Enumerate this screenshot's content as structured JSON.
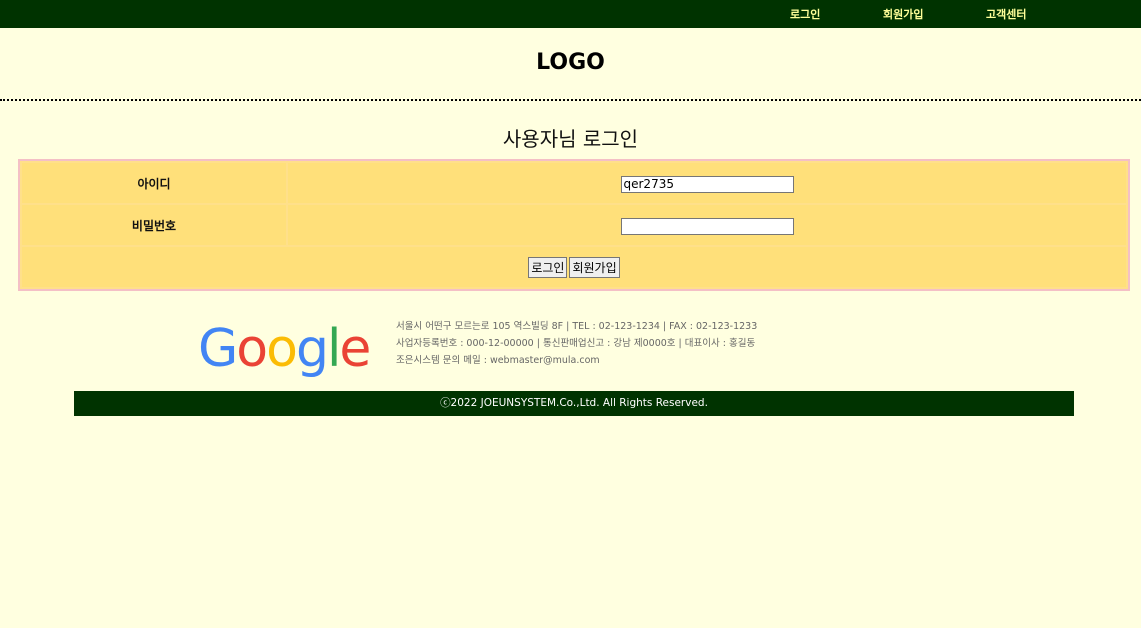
{
  "topnav": {
    "login": "로그인",
    "signup": "회원가입",
    "support": "고객센터"
  },
  "header": {
    "logo": "LOGO"
  },
  "main": {
    "title": "사용자님 로그인",
    "id_label": "아이디",
    "id_value": "qer2735",
    "password_label": "비밀번호",
    "password_value": "",
    "login_button": "로그인",
    "signup_button": "회원가입"
  },
  "footer": {
    "logo_letters": [
      "G",
      "o",
      "o",
      "g",
      "l",
      "e"
    ],
    "address_line": "서울시 어떤구 모르는로 105 역스빌딩 8F | TEL : 02-123-1234 | FAX : 02-123-1233",
    "business_line": "사업자등록번호 : 000-12-00000 | 통신판매업신고 : 강남 제0000호 | 대표이사 : 홍길동",
    "email_line": "조은시스템 문의 메일 : webmaster@mula.com",
    "copyright": "ⓒ2022 JOEUNSYSTEM.Co.,Ltd. All Rights Reserved."
  },
  "colors": {
    "topbar": "#003300",
    "background": "#ffffe0",
    "table_bg": "#ffe07a",
    "table_border": "#f4c0c6",
    "nav_text": "#ffff99"
  }
}
